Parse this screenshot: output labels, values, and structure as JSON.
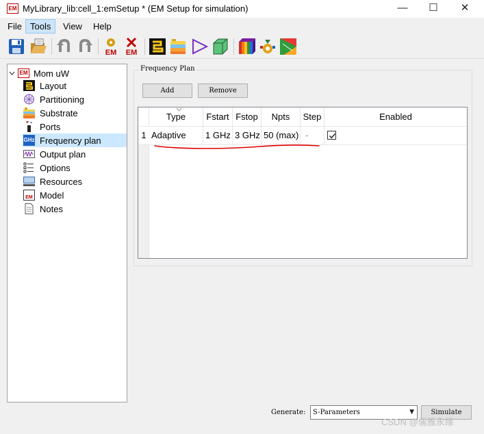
{
  "window": {
    "app_icon": "EM",
    "title": "MyLibrary_lib:cell_1:emSetup * (EM Setup for simulation)",
    "controls": {
      "minimize": "—",
      "maximize": "☐",
      "close": "✕"
    }
  },
  "menu": {
    "items": [
      {
        "label": "File"
      },
      {
        "label": "Tools"
      },
      {
        "label": "View"
      },
      {
        "label": "Help"
      }
    ]
  },
  "toolbar": {
    "buttons": [
      "save-icon",
      "open-folder-icon",
      "undo-icon",
      "redo-icon",
      "em-simulate-icon",
      "em-stop-icon",
      "layout-icon",
      "substrate-icon",
      "port-icon",
      "3d-box-icon",
      "rainbow-cube-icon",
      "gear-mesh-icon",
      "field-plot-icon"
    ],
    "em_text": "EM"
  },
  "tree": {
    "root": {
      "icon_text": "EM",
      "label": "Mom uW"
    },
    "items": [
      {
        "label": "Layout",
        "icon": "layout-icon"
      },
      {
        "label": "Partitioning",
        "icon": "partitioning-icon"
      },
      {
        "label": "Substrate",
        "icon": "substrate-icon"
      },
      {
        "label": "Ports",
        "icon": "ports-icon"
      },
      {
        "label": "Frequency plan",
        "icon": "ghz-icon",
        "icon_text": "GHz",
        "selected": true
      },
      {
        "label": "Output plan",
        "icon": "output-plan-icon"
      },
      {
        "label": "Options",
        "icon": "options-icon"
      },
      {
        "label": "Resources",
        "icon": "resources-icon"
      },
      {
        "label": "Model",
        "icon": "model-icon",
        "icon_text": "EM"
      },
      {
        "label": "Notes",
        "icon": "notes-icon"
      }
    ]
  },
  "frequency_plan": {
    "title": "Frequency Plan",
    "add_label": "Add",
    "remove_label": "Remove",
    "columns": [
      "Type",
      "Fstart",
      "Fstop",
      "Npts",
      "Step",
      "Enabled"
    ],
    "rows": [
      {
        "index": "1",
        "type": "Adaptive",
        "fstart": "1 GHz",
        "fstop": "3 GHz",
        "npts": "50 (max)",
        "step": "-",
        "enabled": true
      }
    ]
  },
  "bottom": {
    "generate_label": "Generate:",
    "generate_value": "S-Parameters",
    "simulate_label": "Simulate"
  },
  "watermark": "CSDN @儒雅永缘",
  "colors": {
    "selected_item": "#cce8ff",
    "menu_active": "#cce4f7",
    "annotation": "#e00000"
  }
}
